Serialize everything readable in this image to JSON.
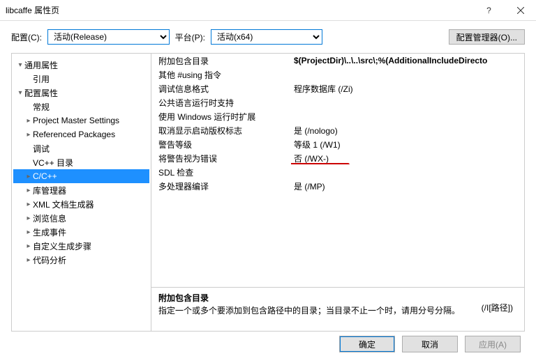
{
  "window": {
    "title": "libcaffe 属性页"
  },
  "toolbar": {
    "config_label": "配置(C):",
    "config_value": "活动(Release)",
    "platform_label": "平台(P):",
    "platform_value": "活动(x64)",
    "config_mgr_label": "配置管理器(O)..."
  },
  "tree": [
    {
      "label": "通用属性",
      "level": 0,
      "expand": "▾"
    },
    {
      "label": "引用",
      "level": 1,
      "expand": ""
    },
    {
      "label": "配置属性",
      "level": 0,
      "expand": "▾"
    },
    {
      "label": "常规",
      "level": 1,
      "expand": ""
    },
    {
      "label": "Project Master Settings",
      "level": 1,
      "expand": "▸"
    },
    {
      "label": "Referenced Packages",
      "level": 1,
      "expand": "▸"
    },
    {
      "label": "调试",
      "level": 1,
      "expand": ""
    },
    {
      "label": "VC++ 目录",
      "level": 1,
      "expand": ""
    },
    {
      "label": "C/C++",
      "level": 1,
      "expand": "▸",
      "selected": true
    },
    {
      "label": "库管理器",
      "level": 1,
      "expand": "▸"
    },
    {
      "label": "XML 文档生成器",
      "level": 1,
      "expand": "▸"
    },
    {
      "label": "浏览信息",
      "level": 1,
      "expand": "▸"
    },
    {
      "label": "生成事件",
      "level": 1,
      "expand": "▸"
    },
    {
      "label": "自定义生成步骤",
      "level": 1,
      "expand": "▸"
    },
    {
      "label": "代码分析",
      "level": 1,
      "expand": "▸"
    }
  ],
  "grid": [
    {
      "k": "附加包含目录",
      "v": "$(ProjectDir)\\..\\..\\src\\;%(AdditionalIncludeDirecto",
      "bold": true
    },
    {
      "k": "其他 #using 指令",
      "v": ""
    },
    {
      "k": "调试信息格式",
      "v": "程序数据库 (/Zi)"
    },
    {
      "k": "公共语言运行时支持",
      "v": ""
    },
    {
      "k": "使用 Windows 运行时扩展",
      "v": ""
    },
    {
      "k": "取消显示启动版权标志",
      "v": "是 (/nologo)"
    },
    {
      "k": "警告等级",
      "v": "等级 1 (/W1)"
    },
    {
      "k": "将警告视为错误",
      "v": "否 (/WX-)",
      "underline": true
    },
    {
      "k": "SDL 检查",
      "v": ""
    },
    {
      "k": "多处理器编译",
      "v": "是 (/MP)"
    }
  ],
  "desc": {
    "title": "附加包含目录",
    "text": "指定一个或多个要添加到包含路径中的目录；当目录不止一个时，请用分号分隔。",
    "hint": "(/I[路径])"
  },
  "buttons": {
    "ok": "确定",
    "cancel": "取消",
    "apply": "应用(A)"
  }
}
